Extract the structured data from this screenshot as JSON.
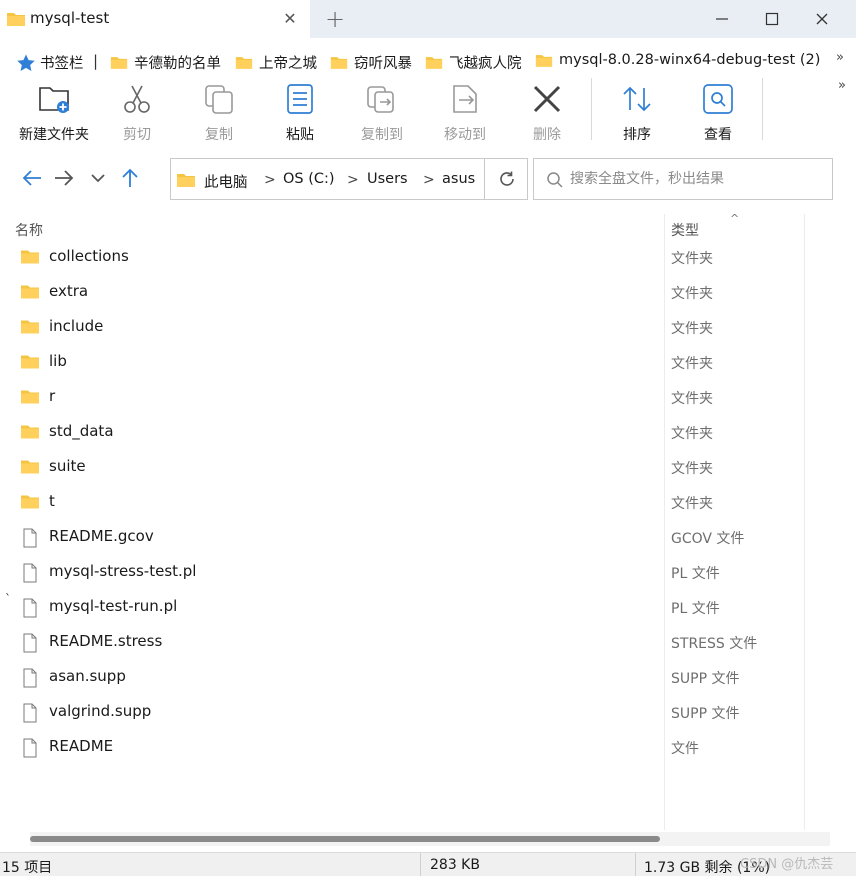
{
  "window": {
    "tab_title": "mysql-test",
    "new_tab_symbol": "+",
    "close_symbol": "✕"
  },
  "bookmarks": {
    "root_label": "书签栏",
    "separator": "|",
    "items": [
      {
        "label": "辛德勒的名单"
      },
      {
        "label": "上帝之城"
      },
      {
        "label": "窃听风暴"
      },
      {
        "label": "飞越疯人院"
      },
      {
        "label": "mysql-8.0.28-winx64-debug-test (2)"
      }
    ],
    "more_symbol": "»"
  },
  "toolbar": {
    "new_folder": "新建文件夹",
    "cut": "剪切",
    "copy": "复制",
    "paste": "粘贴",
    "copy_to": "复制到",
    "move_to": "移动到",
    "delete": "删除",
    "sort": "排序",
    "view": "查看",
    "more_symbol": "»"
  },
  "address": {
    "crumbs": [
      "此电脑",
      "OS (C:)",
      "Users",
      "asus"
    ],
    "chevron": ">"
  },
  "search": {
    "placeholder": "搜索全盘文件，秒出结果"
  },
  "columns": {
    "name": "名称",
    "type": "类型",
    "sort_caret": "^"
  },
  "files": [
    {
      "name": "collections",
      "type": "文件夹",
      "kind": "folder"
    },
    {
      "name": "extra",
      "type": "文件夹",
      "kind": "folder"
    },
    {
      "name": "include",
      "type": "文件夹",
      "kind": "folder"
    },
    {
      "name": "lib",
      "type": "文件夹",
      "kind": "folder"
    },
    {
      "name": "r",
      "type": "文件夹",
      "kind": "folder"
    },
    {
      "name": "std_data",
      "type": "文件夹",
      "kind": "folder"
    },
    {
      "name": "suite",
      "type": "文件夹",
      "kind": "folder"
    },
    {
      "name": "t",
      "type": "文件夹",
      "kind": "folder"
    },
    {
      "name": "README.gcov",
      "type": "GCOV 文件",
      "kind": "file"
    },
    {
      "name": "mysql-stress-test.pl",
      "type": "PL 文件",
      "kind": "file"
    },
    {
      "name": "mysql-test-run.pl",
      "type": "PL 文件",
      "kind": "file"
    },
    {
      "name": "README.stress",
      "type": "STRESS 文件",
      "kind": "file"
    },
    {
      "name": "asan.supp",
      "type": "SUPP 文件",
      "kind": "file"
    },
    {
      "name": "valgrind.supp",
      "type": "SUPP 文件",
      "kind": "file"
    },
    {
      "name": "README",
      "type": "文件",
      "kind": "file"
    }
  ],
  "stray_mark": "`",
  "status": {
    "item_count": "15 项目",
    "size": "283 KB",
    "free_space": "1.73 GB 剩余 (1%)",
    "watermark": "CSDN @仇杰芸"
  },
  "colors": {
    "folder": "#f4c542",
    "accent_blue": "#2f7fd6",
    "titlebar": "#e9eef5"
  }
}
